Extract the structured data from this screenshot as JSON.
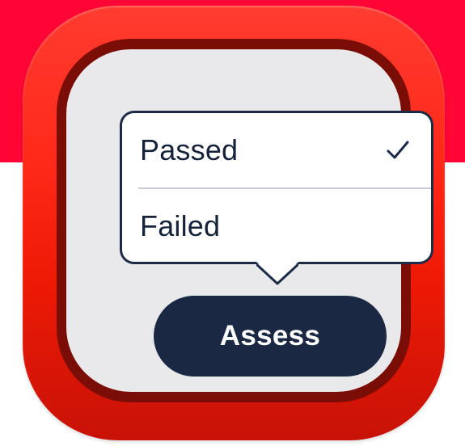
{
  "icon": {
    "name": "assessment-app-icon",
    "colors": {
      "banner": "#ff0637",
      "icon_red": "#ff2a1a",
      "frame_dark": "#7a0d06",
      "face": "#e9e8ea",
      "navy": "#1a2844"
    }
  },
  "menu": {
    "items": [
      {
        "label": "Passed",
        "selected": true,
        "icon": "checkmark-icon"
      },
      {
        "label": "Failed",
        "selected": false
      }
    ]
  },
  "button": {
    "label": "Assess"
  }
}
